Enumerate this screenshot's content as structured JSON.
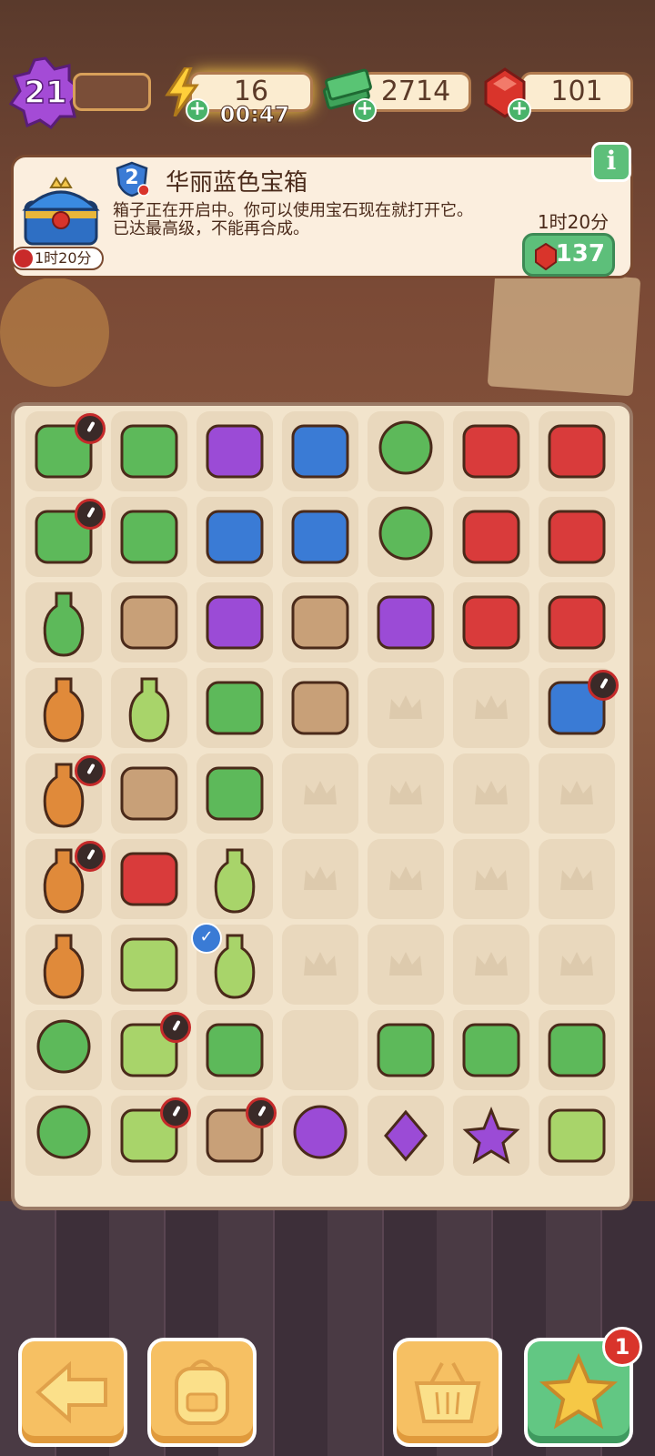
{
  "hud": {
    "level": "21",
    "energy": "16",
    "energy_timer": "00:47",
    "cash": "2714",
    "gems": "101"
  },
  "selected_item": {
    "name": "华丽蓝色宝箱",
    "level": "2",
    "description": "箱子正在开启中。你可以使用宝石现在就打开它。\n已达最高级，不能再合成。",
    "timer": "1时20分",
    "open_time": "1时20分",
    "open_cost": "137"
  },
  "bottom_bar": {
    "notification_count": "1"
  },
  "board": {
    "cols": 7,
    "rows": 9,
    "items": [
      [
        "medical-kit-icon",
        "potted-plant-icon",
        "purple-car-icon",
        "bathtub-room-icon",
        "blossom-tree-icon",
        "red-chest-icon",
        "red-toolbox-open-icon"
      ],
      [
        "medical-kit-icon",
        "seedling-pot-icon",
        "jet-ski-icon",
        "crime-scene-tub-icon",
        "bonsai-tree-icon",
        "red-heart-toolbox-icon",
        "red-wings-icon"
      ],
      [
        "herbal-bottle-icon",
        "empty-pot-icon",
        "motorcycle-icon",
        "evidence-bed-icon",
        "pebbles-icon",
        "red-toolbox-icon",
        "red-box-icon"
      ],
      [
        "vase-icon",
        "spray-bottle-icon",
        "green-glove-icon",
        "evidence-marker-icon",
        "empty",
        "empty",
        "blue-chest-icon"
      ],
      [
        "ornate-vase-icon",
        "rope-coil-icon",
        "green-slime-icon",
        "empty",
        "empty",
        "empty",
        "empty"
      ],
      [
        "decorated-vase-icon",
        "hand-saw-icon",
        "lotion-bottle-icon",
        "empty",
        "empty",
        "empty",
        "empty"
      ],
      [
        "grand-vase-icon",
        "bucket-icon",
        "cleaner-bottle-icon",
        "empty",
        "empty",
        "empty",
        "empty"
      ],
      [
        "flower-bush-icon",
        "mop-bucket-icon",
        "sponge-pad-icon",
        "blank",
        "green-sponge-icon",
        "cash-pile-icon",
        "cash-stack-icon"
      ],
      [
        "flower-bush-icon",
        "cleaning-cart-icon",
        "delivery-crate-icon",
        "purple-flower-icon",
        "purple-gem-icon",
        "purple-star-icon",
        "soap-bar-icon"
      ]
    ]
  },
  "colors": {
    "panel_bg": "#fbeede",
    "board_bg": "#f2e4cc",
    "green_button": "#5dbf7a",
    "orange_button": "#f6c063",
    "energy_glow": "#ffcf4a",
    "gem_red": "#d9342b",
    "level_purple": "#a44bd6"
  }
}
